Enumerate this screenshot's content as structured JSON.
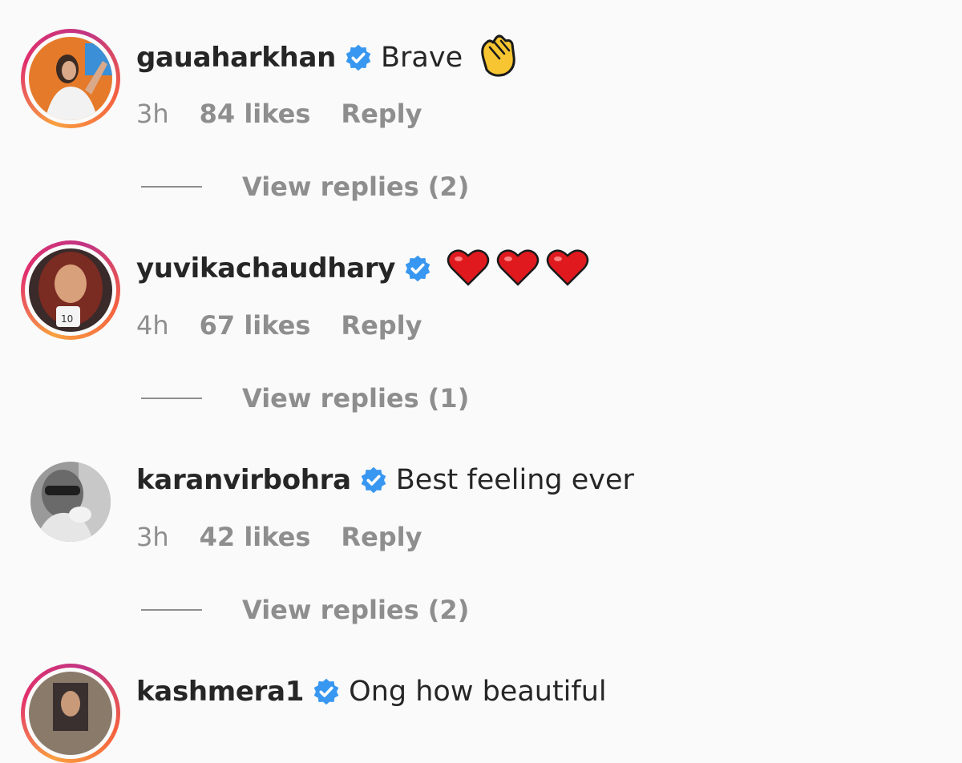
{
  "comments": [
    {
      "username": "gauaharkhan",
      "text": "Brave",
      "emoji": "clapping-hands",
      "time": "3h",
      "likes": "84 likes",
      "reply": "Reply",
      "view_replies": "View replies (2)",
      "ring": true
    },
    {
      "username": "yuvikachaudhary",
      "text": "",
      "emoji": "three-red-hearts",
      "time": "4h",
      "likes": "67 likes",
      "reply": "Reply",
      "view_replies": "View replies (1)",
      "ring": true
    },
    {
      "username": "karanvirbohra",
      "text": "Best feeling ever",
      "time": "3h",
      "likes": "42 likes",
      "reply": "Reply",
      "view_replies": "View replies (2)",
      "ring": false
    },
    {
      "username": "kashmera1",
      "text": "Ong how beautiful",
      "ring": true
    }
  ],
  "colors": {
    "verified": "#3897f0",
    "meta": "#8e8e8e",
    "text": "#262626",
    "heart": "#e0191e"
  }
}
